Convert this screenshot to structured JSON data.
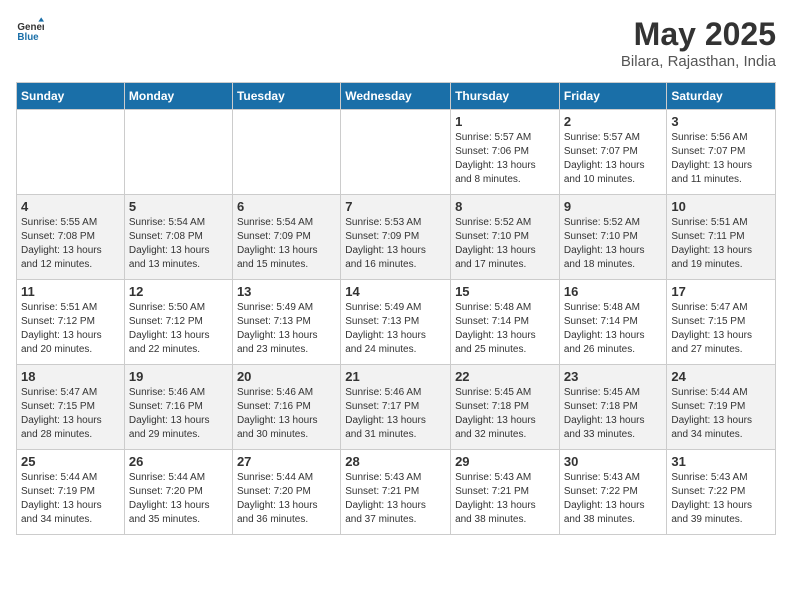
{
  "logo": {
    "text_general": "General",
    "text_blue": "Blue"
  },
  "title": {
    "month": "May 2025",
    "location": "Bilara, Rajasthan, India"
  },
  "days_of_week": [
    "Sunday",
    "Monday",
    "Tuesday",
    "Wednesday",
    "Thursday",
    "Friday",
    "Saturday"
  ],
  "weeks": [
    [
      {
        "day": "",
        "info": ""
      },
      {
        "day": "",
        "info": ""
      },
      {
        "day": "",
        "info": ""
      },
      {
        "day": "",
        "info": ""
      },
      {
        "day": "1",
        "info": "Sunrise: 5:57 AM\nSunset: 7:06 PM\nDaylight: 13 hours\nand 8 minutes."
      },
      {
        "day": "2",
        "info": "Sunrise: 5:57 AM\nSunset: 7:07 PM\nDaylight: 13 hours\nand 10 minutes."
      },
      {
        "day": "3",
        "info": "Sunrise: 5:56 AM\nSunset: 7:07 PM\nDaylight: 13 hours\nand 11 minutes."
      }
    ],
    [
      {
        "day": "4",
        "info": "Sunrise: 5:55 AM\nSunset: 7:08 PM\nDaylight: 13 hours\nand 12 minutes."
      },
      {
        "day": "5",
        "info": "Sunrise: 5:54 AM\nSunset: 7:08 PM\nDaylight: 13 hours\nand 13 minutes."
      },
      {
        "day": "6",
        "info": "Sunrise: 5:54 AM\nSunset: 7:09 PM\nDaylight: 13 hours\nand 15 minutes."
      },
      {
        "day": "7",
        "info": "Sunrise: 5:53 AM\nSunset: 7:09 PM\nDaylight: 13 hours\nand 16 minutes."
      },
      {
        "day": "8",
        "info": "Sunrise: 5:52 AM\nSunset: 7:10 PM\nDaylight: 13 hours\nand 17 minutes."
      },
      {
        "day": "9",
        "info": "Sunrise: 5:52 AM\nSunset: 7:10 PM\nDaylight: 13 hours\nand 18 minutes."
      },
      {
        "day": "10",
        "info": "Sunrise: 5:51 AM\nSunset: 7:11 PM\nDaylight: 13 hours\nand 19 minutes."
      }
    ],
    [
      {
        "day": "11",
        "info": "Sunrise: 5:51 AM\nSunset: 7:12 PM\nDaylight: 13 hours\nand 20 minutes."
      },
      {
        "day": "12",
        "info": "Sunrise: 5:50 AM\nSunset: 7:12 PM\nDaylight: 13 hours\nand 22 minutes."
      },
      {
        "day": "13",
        "info": "Sunrise: 5:49 AM\nSunset: 7:13 PM\nDaylight: 13 hours\nand 23 minutes."
      },
      {
        "day": "14",
        "info": "Sunrise: 5:49 AM\nSunset: 7:13 PM\nDaylight: 13 hours\nand 24 minutes."
      },
      {
        "day": "15",
        "info": "Sunrise: 5:48 AM\nSunset: 7:14 PM\nDaylight: 13 hours\nand 25 minutes."
      },
      {
        "day": "16",
        "info": "Sunrise: 5:48 AM\nSunset: 7:14 PM\nDaylight: 13 hours\nand 26 minutes."
      },
      {
        "day": "17",
        "info": "Sunrise: 5:47 AM\nSunset: 7:15 PM\nDaylight: 13 hours\nand 27 minutes."
      }
    ],
    [
      {
        "day": "18",
        "info": "Sunrise: 5:47 AM\nSunset: 7:15 PM\nDaylight: 13 hours\nand 28 minutes."
      },
      {
        "day": "19",
        "info": "Sunrise: 5:46 AM\nSunset: 7:16 PM\nDaylight: 13 hours\nand 29 minutes."
      },
      {
        "day": "20",
        "info": "Sunrise: 5:46 AM\nSunset: 7:16 PM\nDaylight: 13 hours\nand 30 minutes."
      },
      {
        "day": "21",
        "info": "Sunrise: 5:46 AM\nSunset: 7:17 PM\nDaylight: 13 hours\nand 31 minutes."
      },
      {
        "day": "22",
        "info": "Sunrise: 5:45 AM\nSunset: 7:18 PM\nDaylight: 13 hours\nand 32 minutes."
      },
      {
        "day": "23",
        "info": "Sunrise: 5:45 AM\nSunset: 7:18 PM\nDaylight: 13 hours\nand 33 minutes."
      },
      {
        "day": "24",
        "info": "Sunrise: 5:44 AM\nSunset: 7:19 PM\nDaylight: 13 hours\nand 34 minutes."
      }
    ],
    [
      {
        "day": "25",
        "info": "Sunrise: 5:44 AM\nSunset: 7:19 PM\nDaylight: 13 hours\nand 34 minutes."
      },
      {
        "day": "26",
        "info": "Sunrise: 5:44 AM\nSunset: 7:20 PM\nDaylight: 13 hours\nand 35 minutes."
      },
      {
        "day": "27",
        "info": "Sunrise: 5:44 AM\nSunset: 7:20 PM\nDaylight: 13 hours\nand 36 minutes."
      },
      {
        "day": "28",
        "info": "Sunrise: 5:43 AM\nSunset: 7:21 PM\nDaylight: 13 hours\nand 37 minutes."
      },
      {
        "day": "29",
        "info": "Sunrise: 5:43 AM\nSunset: 7:21 PM\nDaylight: 13 hours\nand 38 minutes."
      },
      {
        "day": "30",
        "info": "Sunrise: 5:43 AM\nSunset: 7:22 PM\nDaylight: 13 hours\nand 38 minutes."
      },
      {
        "day": "31",
        "info": "Sunrise: 5:43 AM\nSunset: 7:22 PM\nDaylight: 13 hours\nand 39 minutes."
      }
    ]
  ]
}
